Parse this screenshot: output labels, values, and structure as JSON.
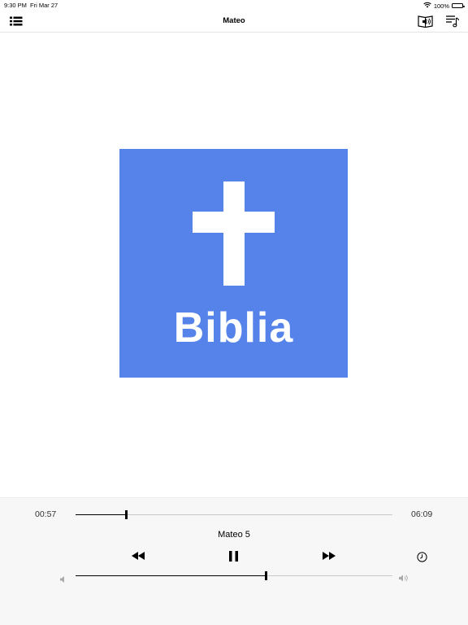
{
  "status_bar": {
    "time": "9:30 PM",
    "date": "Fri Mar 27",
    "battery": "100%"
  },
  "nav": {
    "title": "Mateo"
  },
  "artwork": {
    "text": "Biblia",
    "color": "#5583ea"
  },
  "player": {
    "elapsed": "00:57",
    "duration": "06:09",
    "progress": 0.16,
    "track_title": "Mateo 5",
    "volume": 0.6
  }
}
